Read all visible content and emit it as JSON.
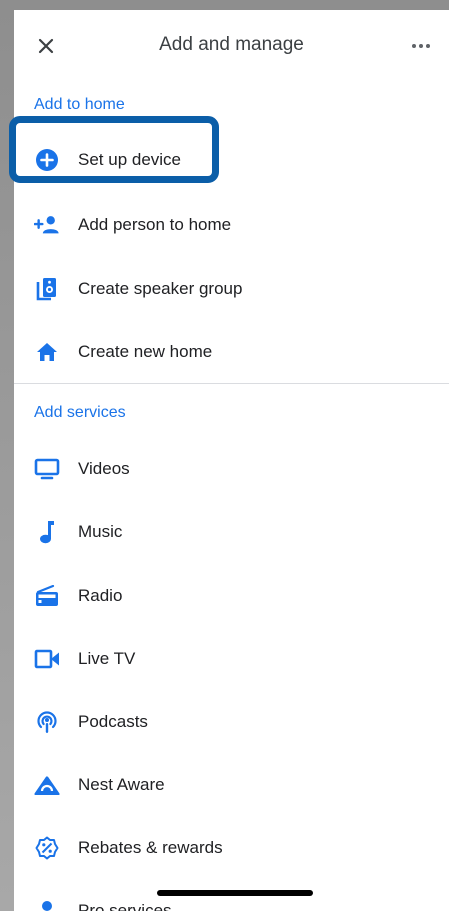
{
  "header": {
    "title": "Add and manage",
    "close_icon": "close-icon",
    "more_icon": "more-horizontal-icon"
  },
  "sections": {
    "add_to_home": {
      "title": "Add to home",
      "items": [
        {
          "label": "Set up device",
          "icon": "add-circle-icon"
        },
        {
          "label": "Add person to home",
          "icon": "person-add-icon"
        },
        {
          "label": "Create speaker group",
          "icon": "speaker-group-icon"
        },
        {
          "label": "Create new home",
          "icon": "home-icon"
        }
      ]
    },
    "add_services": {
      "title": "Add services",
      "items": [
        {
          "label": "Videos",
          "icon": "tv-icon"
        },
        {
          "label": "Music",
          "icon": "music-note-icon"
        },
        {
          "label": "Radio",
          "icon": "radio-icon"
        },
        {
          "label": "Live TV",
          "icon": "videocam-icon"
        },
        {
          "label": "Podcasts",
          "icon": "podcasts-icon"
        },
        {
          "label": "Nest Aware",
          "icon": "nest-aware-icon"
        },
        {
          "label": "Rebates & rewards",
          "icon": "rebates-icon"
        },
        {
          "label": "Pro services",
          "icon": "pro-services-icon"
        }
      ]
    }
  },
  "colors": {
    "accent": "#1a73e8",
    "highlight_border": "#0b5ea8",
    "text": "#202124"
  }
}
